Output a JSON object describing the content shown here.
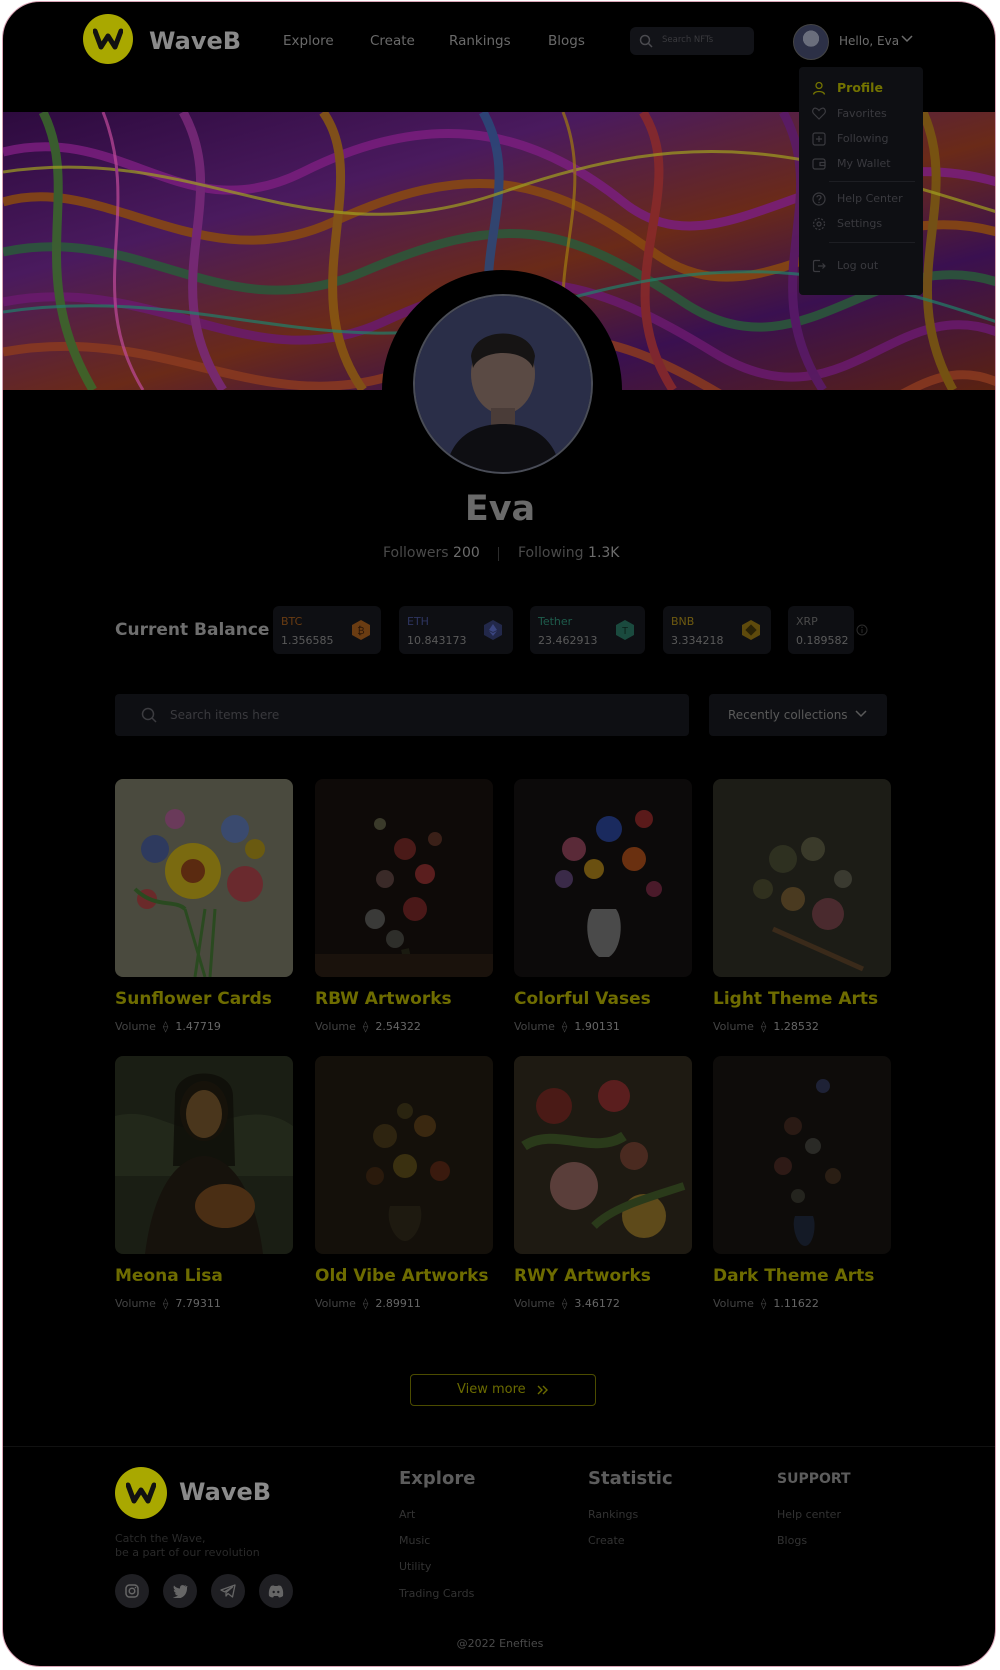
{
  "header": {
    "brand": "WaveB",
    "nav": [
      "Explore",
      "Create",
      "Rankings",
      "Blogs"
    ],
    "search_placeholder": "Search NFTs",
    "greeting": "Hello, Eva"
  },
  "dropdown": {
    "items": [
      "Profile",
      "Favorites",
      "Following",
      "My Wallet",
      "Help Center",
      "Settings",
      "Log out"
    ]
  },
  "profile": {
    "name": "Eva",
    "followers_label": "Followers",
    "followers_value": "200",
    "following_label": "Following",
    "following_value": "1.3K"
  },
  "balance": {
    "title": "Current Balance",
    "coins": [
      {
        "symbol": "BTC",
        "value": "1.356585",
        "color": "#7a4a1e"
      },
      {
        "symbol": "ETH",
        "value": "10.843173",
        "color": "#2e3560"
      },
      {
        "symbol": "Tether",
        "value": "23.462913",
        "color": "#1e5c4c"
      },
      {
        "symbol": "BNB",
        "value": "3.334218",
        "color": "#6e5a10"
      },
      {
        "symbol": "XRP",
        "value": "0.189582",
        "color": "#3a3a3a"
      }
    ]
  },
  "items_search": {
    "placeholder": "Search items here",
    "sort_selected": "Recently collections"
  },
  "collections": [
    {
      "title": "Sunflower Cards",
      "volume_label": "Volume",
      "volume": "1.47719"
    },
    {
      "title": "RBW Artworks",
      "volume_label": "Volume",
      "volume": "2.54322"
    },
    {
      "title": "Colorful Vases",
      "volume_label": "Volume",
      "volume": "1.90131"
    },
    {
      "title": "Light Theme Arts",
      "volume_label": "Volume",
      "volume": "1.28532"
    },
    {
      "title": "Meona Lisa",
      "volume_label": "Volume",
      "volume": "7.79311"
    },
    {
      "title": "Old Vibe Artworks",
      "volume_label": "Volume",
      "volume": "2.89911"
    },
    {
      "title": "RWY Artworks",
      "volume_label": "Volume",
      "volume": "3.46172"
    },
    {
      "title": "Dark Theme Arts",
      "volume_label": "Volume",
      "volume": "1.11622"
    }
  ],
  "view_more": "View more",
  "footer": {
    "brand": "WaveB",
    "tagline_1": "Catch the Wave,",
    "tagline_2": "be a part of our revolution",
    "socials": [
      "instagram-icon",
      "twitter-icon",
      "telegram-icon",
      "discord-icon"
    ],
    "explore": {
      "title": "Explore",
      "links": [
        "Art",
        "Music",
        "Utility",
        "Trading Cards"
      ]
    },
    "statistic": {
      "title": "Statistic",
      "links": [
        "Rankings",
        "Create"
      ]
    },
    "support": {
      "title": "SUPPORT",
      "links": [
        "Help center",
        "Blogs"
      ]
    },
    "copyright": "@2022 Enefties"
  },
  "colors": {
    "accent": "#a9a800",
    "background": "#000000",
    "panel": "#0e0f13"
  }
}
